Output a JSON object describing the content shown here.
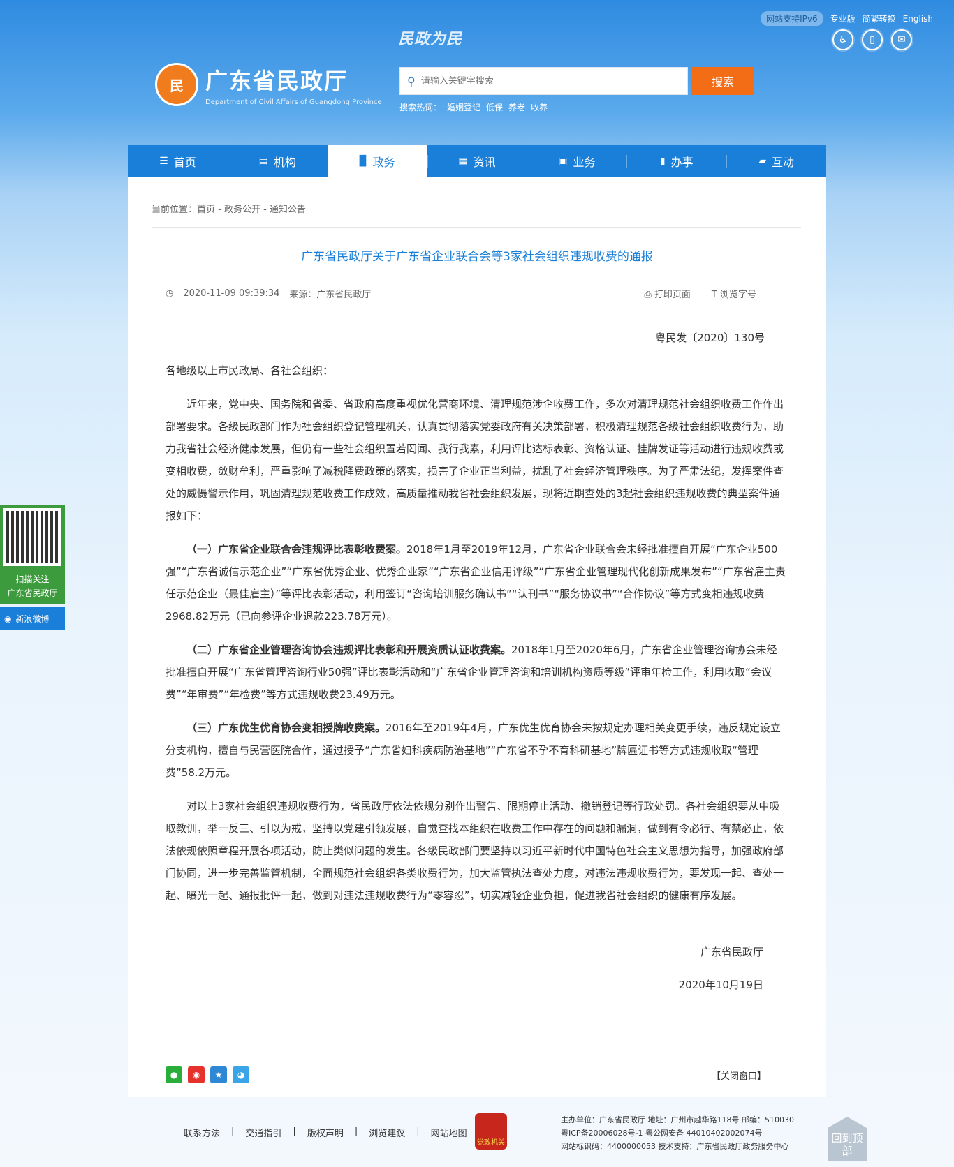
{
  "header": {
    "ipv6": "网站支持IPv6",
    "links": [
      "专业版",
      "简繁转换",
      "English"
    ],
    "slogan": "民政为民",
    "title": "广东省民政厅",
    "subtitle": "Department of Civil Affairs of Guangdong Province",
    "search_placeholder": "请输入关键字搜索",
    "search_button": "搜索",
    "hot_label": "搜索热词：",
    "hot_words": [
      "婚姻登记",
      "低保",
      "养老",
      "收养"
    ]
  },
  "nav": [
    {
      "label": "首页",
      "icon": "list-icon"
    },
    {
      "label": "机构",
      "icon": "building-icon"
    },
    {
      "label": "政务",
      "icon": "book-icon"
    },
    {
      "label": "资讯",
      "icon": "news-icon"
    },
    {
      "label": "业务",
      "icon": "briefcase-icon"
    },
    {
      "label": "办事",
      "icon": "clipboard-icon"
    },
    {
      "label": "互动",
      "icon": "chat-icon"
    }
  ],
  "breadcrumb": "当前位置：首页 - 政务公开 - 通知公告",
  "article": {
    "title": "广东省民政厅关于广东省企业联合会等3家社会组织违规收费的通报",
    "datetime": "2020-11-09 09:39:34",
    "source": "来源：广东省民政厅",
    "print": "打印页面",
    "font_size": "浏览字号",
    "doc_no": "粤民发〔2020〕130号",
    "salutation": "各地级以上市民政局、各社会组织：",
    "p1": "近年来，党中央、国务院和省委、省政府高度重视优化营商环境、清理规范涉企收费工作，多次对清理规范社会组织收费工作作出部署要求。各级民政部门作为社会组织登记管理机关，认真贯彻落实党委政府有关决策部署，积极清理规范各级社会组织收费行为，助力我省社会经济健康发展，但仍有一些社会组织置若罔闻、我行我素，利用评比达标表彰、资格认证、挂牌发证等活动进行违规收费或变相收费，敛财牟利，严重影响了减税降费政策的落实，损害了企业正当利益，扰乱了社会经济管理秩序。为了严肃法纪，发挥案件查处的威慑警示作用，巩固清理规范收费工作成效，高质量推动我省社会组织发展，现将近期查处的3起社会组织违规收费的典型案件通报如下：",
    "c1_title": "（一）广东省企业联合会违规评比表彰收费案。",
    "c1_text": "2018年1月至2019年12月，广东省企业联合会未经批准擅自开展“广东企业500强”“广东省诚信示范企业”“广东省优秀企业、优秀企业家”“广东省企业信用评级”“广东省企业管理现代化创新成果发布”“广东省雇主责任示范企业（最佳雇主）”等评比表彰活动，利用签订“咨询培训服务确认书”“认刊书”“服务协议书”“合作协议”等方式变相违规收费2968.82万元（已向参评企业退款223.78万元）。",
    "c2_title": "（二）广东省企业管理咨询协会违规评比表彰和开展资质认证收费案。",
    "c2_text": "2018年1月至2020年6月，广东省企业管理咨询协会未经批准擅自开展“广东省管理咨询行业50强”评比表彰活动和“广东省企业管理咨询和培训机构资质等级”评审年检工作，利用收取“会议费”“年审费”“年检费”等方式违规收费23.49万元。",
    "c3_title": "（三）广东优生优育协会变相授牌收费案。",
    "c3_text": "2016年至2019年4月，广东优生优育协会未按规定办理相关变更手续，违反规定设立分支机构，擅自与民营医院合作，通过授予“广东省妇科疾病防治基地”“广东省不孕不育科研基地”牌匾证书等方式违规收取“管理费”58.2万元。",
    "p_end": "对以上3家社会组织违规收费行为，省民政厅依法依规分别作出警告、限期停止活动、撤销登记等行政处罚。各社会组织要从中吸取教训，举一反三、引以为戒，坚持以党建引领发展，自觉查找本组织在收费工作中存在的问题和漏洞，做到有令必行、有禁必止，依法依规依照章程开展各项活动，防止类似问题的发生。各级民政部门要坚持以习近平新时代中国特色社会主义思想为指导，加强政府部门协同，进一步完善监管机制，全面规范社会组织各类收费行为，加大监管执法查处力度，对违法违规收费行为，要发现一起、查处一起、曝光一起、通报批评一起，做到对违法违规收费行为“零容忍”，切实减轻企业负担，促进我省社会组织的健康有序发展。",
    "signer": "广东省民政厅",
    "date": "2020年10月19日",
    "close": "【关闭窗口】"
  },
  "float": {
    "qr_text1": "扫描关注",
    "qr_text2": "广东省民政厅",
    "weibo": "新浪微博"
  },
  "footer": {
    "links": [
      "联系方法",
      "交通指引",
      "版权声明",
      "浏览建议",
      "网站地图"
    ],
    "party": "党政机关",
    "line1": "主办单位：广东省民政厅  地址：广州市越华路118号  邮编：510030",
    "line2": "粤ICP备20006028号-1    粤公网安备 44010402002074号",
    "line3": "网站标识码：4400000053  技术支持：广东省民政厅政务服务中心",
    "backtop": "回到顶部"
  }
}
